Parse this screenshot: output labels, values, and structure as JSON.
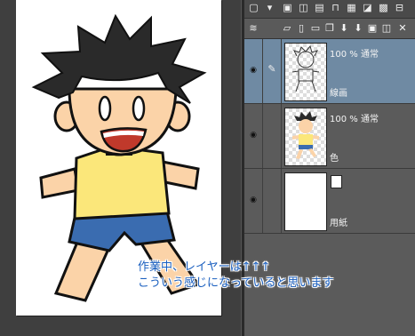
{
  "caption": {
    "line1": "作業中、レイヤーは↑↑↑",
    "line2": "こういう感じになっていると思います"
  },
  "layers": [
    {
      "mode": "100 % 通常",
      "name": "線画",
      "selected": true
    },
    {
      "mode": "100 % 通常",
      "name": "色",
      "selected": false
    },
    {
      "mode": "",
      "name": "用紙",
      "selected": false
    }
  ],
  "icons": {
    "visibility": "eye-icon",
    "edit": "pencil-icon",
    "paper": "paper-layer-icon"
  },
  "colors": {
    "selected_layer": "#6f8aa3",
    "caption_text": "#1a5fbf",
    "shirt": "#fbe77a",
    "shorts": "#3a6cb0",
    "skin": "#fbd3a8",
    "hair": "#2a2a2a"
  }
}
